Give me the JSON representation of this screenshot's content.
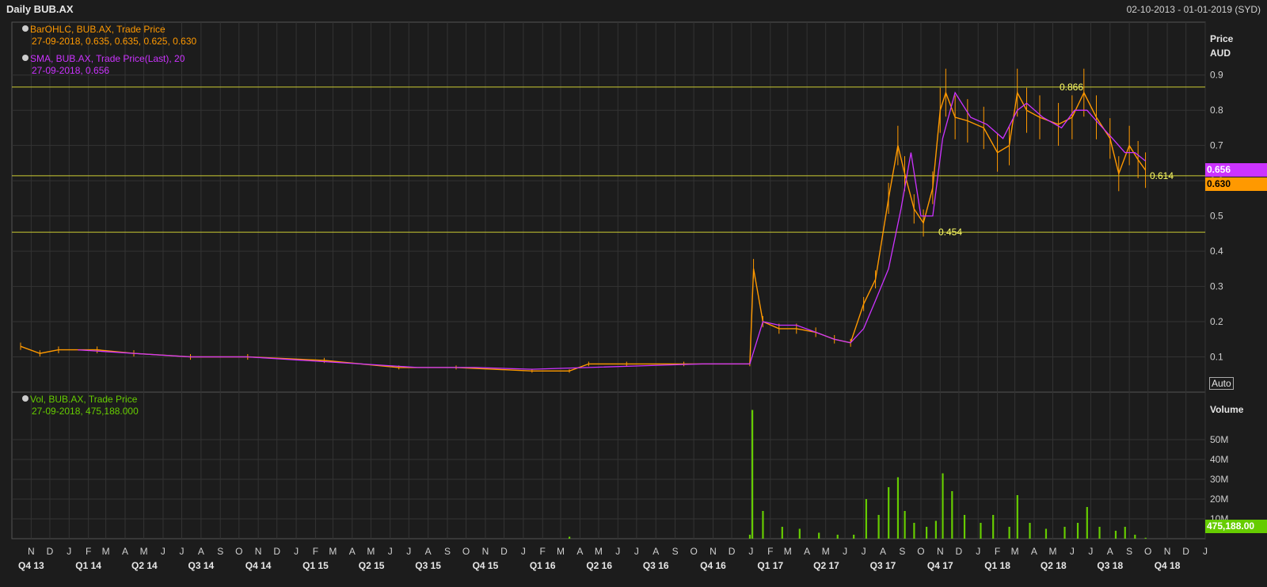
{
  "header": {
    "title": "Daily BUB.AX",
    "range": "02-10-2013 - 01-01-2019 (SYD)"
  },
  "legend": {
    "ohlc_title": "BarOHLC, BUB.AX, Trade Price",
    "ohlc_values": "27-09-2018, 0.635, 0.635, 0.625, 0.630",
    "sma_title": "SMA, BUB.AX, Trade Price(Last),  20",
    "sma_values": "27-09-2018, 0.656",
    "vol_title": "Vol, BUB.AX, Trade Price",
    "vol_values": "27-09-2018, 475,188.000"
  },
  "axis": {
    "price_label": "Price",
    "price_unit": "AUD",
    "volume_label": "Volume",
    "auto_label": "Auto"
  },
  "badges": {
    "sma": "0.656",
    "last": "0.630",
    "volume": "475,188.00"
  },
  "colors": {
    "price": "#ff9900",
    "sma": "#cc33ff",
    "volume": "#66cc00",
    "level": "#cccc33",
    "background": "#1c1c1c",
    "grid": "#333333"
  },
  "chart_data": {
    "type": "line",
    "ylim": [
      0,
      1.05
    ],
    "y_ticks": [
      "0.9",
      "0.8",
      "0.7",
      "0.6",
      "0.5",
      "0.4",
      "0.3",
      "0.2",
      "0.1"
    ],
    "y_tick_values": [
      0.9,
      0.8,
      0.7,
      0.6,
      0.5,
      0.4,
      0.3,
      0.2,
      0.1
    ],
    "volume_ticks": [
      "50M",
      "40M",
      "30M",
      "20M",
      "10M"
    ],
    "volume_tick_values": [
      50,
      40,
      30,
      20,
      10
    ],
    "x_months": [
      "N",
      "D",
      "J",
      "F",
      "M",
      "A",
      "M",
      "J",
      "J",
      "A",
      "S",
      "O",
      "N",
      "D",
      "J",
      "F",
      "M",
      "A",
      "M",
      "J",
      "J",
      "A",
      "S",
      "O",
      "N",
      "D",
      "J",
      "F",
      "M",
      "A",
      "M",
      "J",
      "J",
      "A",
      "S",
      "O",
      "N",
      "D",
      "J",
      "F",
      "M",
      "A",
      "M",
      "J",
      "J",
      "A",
      "S",
      "O",
      "N",
      "D",
      "J",
      "F",
      "M",
      "A",
      "M",
      "J",
      "J",
      "A",
      "S",
      "O",
      "N",
      "D",
      "J"
    ],
    "x_quarters": [
      "Q4 13",
      "Q1 14",
      "Q2 14",
      "Q3 14",
      "Q4 14",
      "Q1 15",
      "Q2 15",
      "Q3 15",
      "Q4 15",
      "Q1 16",
      "Q2 16",
      "Q3 16",
      "Q4 16",
      "Q1 17",
      "Q2 17",
      "Q3 17",
      "Q4 17",
      "Q1 18",
      "Q2 18",
      "Q3 18",
      "Q4 18"
    ],
    "levels": [
      {
        "label": "0.866",
        "value": 0.866
      },
      {
        "label": "0.614",
        "value": 0.614
      },
      {
        "label": "0.454",
        "value": 0.454
      }
    ],
    "series": [
      {
        "name": "BarOHLC, BUB.AX, Trade Price",
        "x": [
          "2013-10",
          "2013-11",
          "2013-12",
          "2014-02",
          "2014-04",
          "2014-07",
          "2014-10",
          "2015-02",
          "2015-06",
          "2015-09",
          "2016-01",
          "2016-03",
          "2016-04",
          "2016-06",
          "2016-09",
          "2016-12-30",
          "2017-01-05",
          "2017-01-20",
          "2017-02-15",
          "2017-03-15",
          "2017-04-15",
          "2017-05-15",
          "2017-06-10",
          "2017-07-01",
          "2017-07-20",
          "2017-08-10",
          "2017-08-25",
          "2017-09-05",
          "2017-09-20",
          "2017-10-05",
          "2017-10-20",
          "2017-11-01",
          "2017-11-10",
          "2017-11-25",
          "2017-12-15",
          "2018-01-10",
          "2018-02-01",
          "2018-02-20",
          "2018-03-05",
          "2018-03-20",
          "2018-04-10",
          "2018-05-10",
          "2018-06-01",
          "2018-06-20",
          "2018-07-10",
          "2018-08-01",
          "2018-08-15",
          "2018-09-01",
          "2018-09-15",
          "2018-09-27"
        ],
        "values": [
          0.13,
          0.11,
          0.12,
          0.12,
          0.11,
          0.1,
          0.1,
          0.09,
          0.07,
          0.07,
          0.06,
          0.06,
          0.08,
          0.08,
          0.08,
          0.08,
          0.35,
          0.2,
          0.18,
          0.18,
          0.17,
          0.15,
          0.14,
          0.25,
          0.32,
          0.55,
          0.7,
          0.62,
          0.52,
          0.48,
          0.58,
          0.8,
          0.85,
          0.78,
          0.77,
          0.75,
          0.68,
          0.7,
          0.85,
          0.8,
          0.78,
          0.76,
          0.78,
          0.85,
          0.78,
          0.72,
          0.62,
          0.7,
          0.66,
          0.63
        ]
      },
      {
        "name": "SMA, BUB.AX, Trade Price(Last),  20",
        "x": [
          "2014-01",
          "2014-04",
          "2014-07",
          "2014-10",
          "2015-01",
          "2015-04",
          "2015-07",
          "2015-10",
          "2016-01",
          "2016-04",
          "2016-07",
          "2016-10",
          "2016-12-30",
          "2017-01-20",
          "2017-02-15",
          "2017-03-15",
          "2017-04-15",
          "2017-05-15",
          "2017-06-10",
          "2017-07-01",
          "2017-07-20",
          "2017-08-10",
          "2017-08-30",
          "2017-09-15",
          "2017-10-01",
          "2017-10-20",
          "2017-11-05",
          "2017-11-25",
          "2017-12-20",
          "2018-01-15",
          "2018-02-10",
          "2018-03-05",
          "2018-03-20",
          "2018-04-15",
          "2018-05-15",
          "2018-06-05",
          "2018-06-25",
          "2018-07-15",
          "2018-08-05",
          "2018-08-25",
          "2018-09-10",
          "2018-09-27"
        ],
        "values": [
          0.12,
          0.11,
          0.1,
          0.1,
          0.09,
          0.08,
          0.07,
          0.07,
          0.065,
          0.07,
          0.075,
          0.08,
          0.08,
          0.2,
          0.19,
          0.19,
          0.17,
          0.15,
          0.14,
          0.18,
          0.26,
          0.35,
          0.52,
          0.68,
          0.5,
          0.5,
          0.72,
          0.85,
          0.78,
          0.76,
          0.72,
          0.8,
          0.82,
          0.78,
          0.75,
          0.8,
          0.8,
          0.76,
          0.72,
          0.68,
          0.68,
          0.656
        ]
      },
      {
        "name": "Vol, BUB.AX, Trade Price",
        "x": [
          "2016-03",
          "2016-12-30",
          "2017-01-03",
          "2017-01-20",
          "2017-02-20",
          "2017-03-20",
          "2017-04-20",
          "2017-05-20",
          "2017-06-15",
          "2017-07-05",
          "2017-07-25",
          "2017-08-10",
          "2017-08-25",
          "2017-09-05",
          "2017-09-20",
          "2017-10-10",
          "2017-10-25",
          "2017-11-05",
          "2017-11-20",
          "2017-12-10",
          "2018-01-05",
          "2018-01-25",
          "2018-02-20",
          "2018-03-05",
          "2018-03-25",
          "2018-04-20",
          "2018-05-20",
          "2018-06-10",
          "2018-06-25",
          "2018-07-15",
          "2018-08-10",
          "2018-08-25",
          "2018-09-10",
          "2018-09-27"
        ],
        "values": [
          1,
          2,
          65,
          14,
          6,
          5,
          3,
          2,
          2,
          20,
          12,
          26,
          31,
          14,
          8,
          6,
          9,
          33,
          24,
          12,
          8,
          12,
          6,
          22,
          8,
          5,
          6,
          8,
          16,
          6,
          4,
          6,
          2,
          0.475
        ]
      }
    ]
  }
}
